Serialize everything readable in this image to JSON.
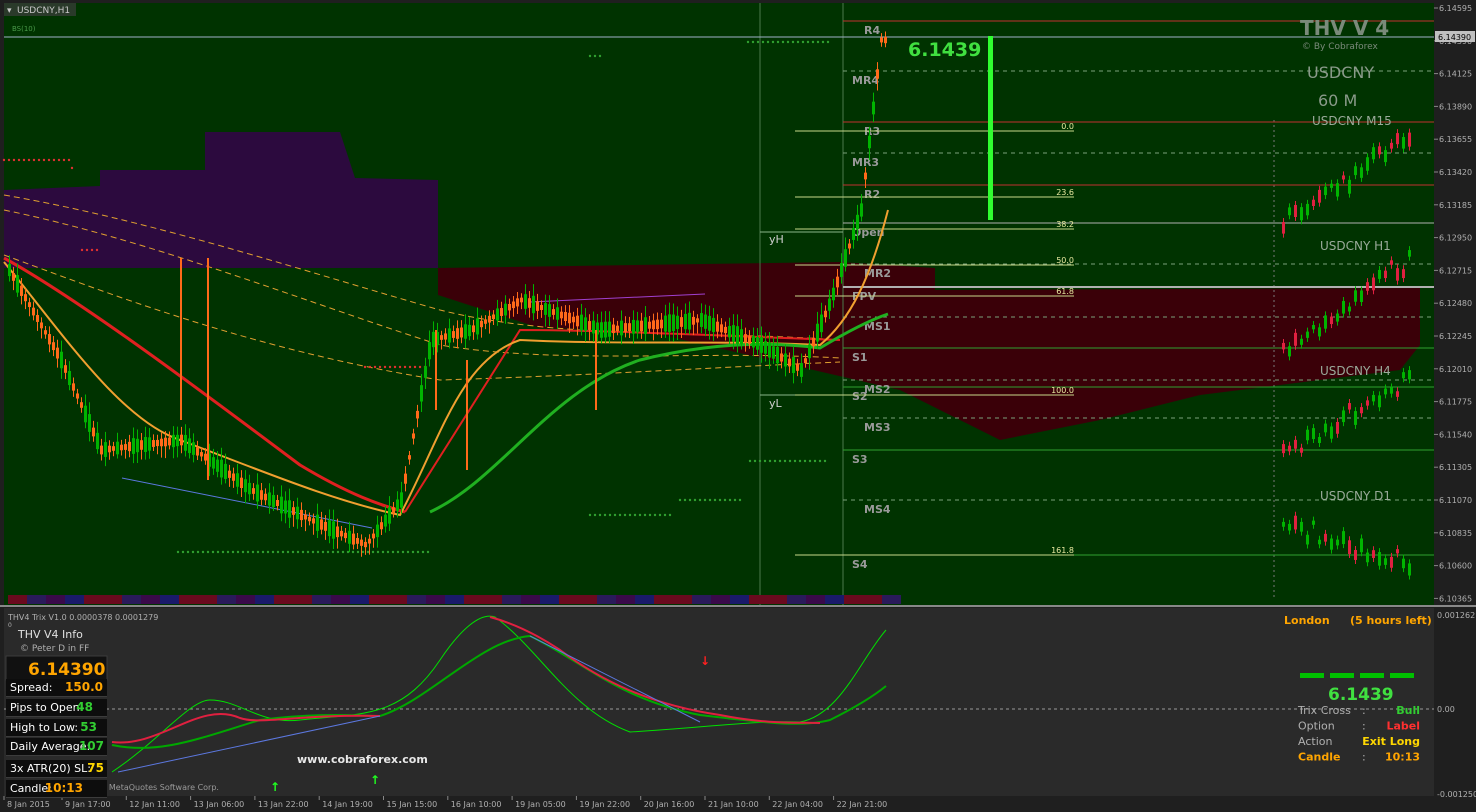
{
  "symbol_tab": "USDCNY,H1",
  "indicator_tag": "BS(10)",
  "pivot_labels": [
    "R4",
    "MR4",
    "R3",
    "MR3",
    "R2",
    "Open",
    "MR2",
    "FPV",
    "MS1",
    "S1",
    "MS2",
    "S2",
    "MS3",
    "S3",
    "MS4",
    "S4"
  ],
  "day_labels": {
    "yh": "yH",
    "yl": "yL"
  },
  "fib_labels": [
    "0.0",
    "23.6",
    "38.2",
    "50.0",
    "61.8",
    "100.0",
    "161.8"
  ],
  "big_price": "6.1439",
  "brand": {
    "title": "THV V 4",
    "credit": "© By Cobraforex",
    "symbol": "USDCNY",
    "period": "60 M"
  },
  "mini_chart_titles": [
    "USDCNY M15",
    "USDCNY H1",
    "USDCNY H4",
    "USDCNY D1"
  ],
  "price_axis": {
    "ticks": [
      "6.14595",
      "6.14390",
      "6.14125",
      "6.13890",
      "6.13655",
      "6.13420",
      "6.13185",
      "6.12950",
      "6.12715",
      "6.12480",
      "6.12245",
      "6.12010",
      "6.11775",
      "6.11540",
      "6.11305",
      "6.11070",
      "6.10835",
      "6.10600",
      "6.10365"
    ],
    "current_tag": "6.14390"
  },
  "sub_window": {
    "title": "THV4 Trix V1.0 0.0000378 0.0001279",
    "zero_marker": "0",
    "axis_ticks": [
      "0.001262",
      "0.00",
      "-0.001250"
    ],
    "watermark": "www.cobraforex.com",
    "copyright": "Copyright © 2001-2014, MetaQuotes Software Corp."
  },
  "info_panel": {
    "title": "THV  V4  Info",
    "subtitle": "© Peter D in FF",
    "price": "6.14390",
    "rows": [
      {
        "label": "Spread:",
        "value": "150.0",
        "color": "#ffa500"
      },
      {
        "label": "Pips to Open:",
        "value": "48",
        "color": "#32cd32"
      },
      {
        "label": "High to Low:",
        "value": "53",
        "color": "#32cd32"
      },
      {
        "label": "Daily Average:",
        "value": "107",
        "color": "#32cd32"
      },
      {
        "label": "3x ATR(20) SL:",
        "value": "75",
        "color": "#ffd700"
      },
      {
        "label": "Candle:",
        "value": "10:13",
        "color": "#ffa500"
      }
    ]
  },
  "session": {
    "name": "London",
    "remaining": "(5 hours left)"
  },
  "signal_panel": {
    "price": "6.1439",
    "rows": [
      {
        "label": "Trix Cross",
        "sep": ":",
        "value": "Bull",
        "color": "#32cd32"
      },
      {
        "label": "Option",
        "sep": ":",
        "value": "Label",
        "color": "#ff3030"
      },
      {
        "label": "Action",
        "sep": ":",
        "value": "Exit Long",
        "color": "#ffd700"
      },
      {
        "label": "Candle",
        "sep": ":",
        "value": "10:13",
        "color": "#ffa500"
      }
    ]
  },
  "time_axis": [
    "8 Jan 2015",
    "9 Jan 17:00",
    "12 Jan 11:00",
    "13 Jan 06:00",
    "13 Jan 22:00",
    "14 Jan 19:00",
    "15 Jan 15:00",
    "16 Jan 10:00",
    "19 Jan 05:00",
    "19 Jan 22:00",
    "20 Jan 16:00",
    "21 Jan 10:00",
    "22 Jan 04:00",
    "22 Jan 21:00"
  ],
  "colors": {
    "chart_bg": "#003300",
    "bull": "#00b400",
    "bear": "#ff6a1a",
    "cloud_top": "#2c0a3e",
    "cloud_bottom": "#3a0008",
    "accent": "#00ff00"
  }
}
